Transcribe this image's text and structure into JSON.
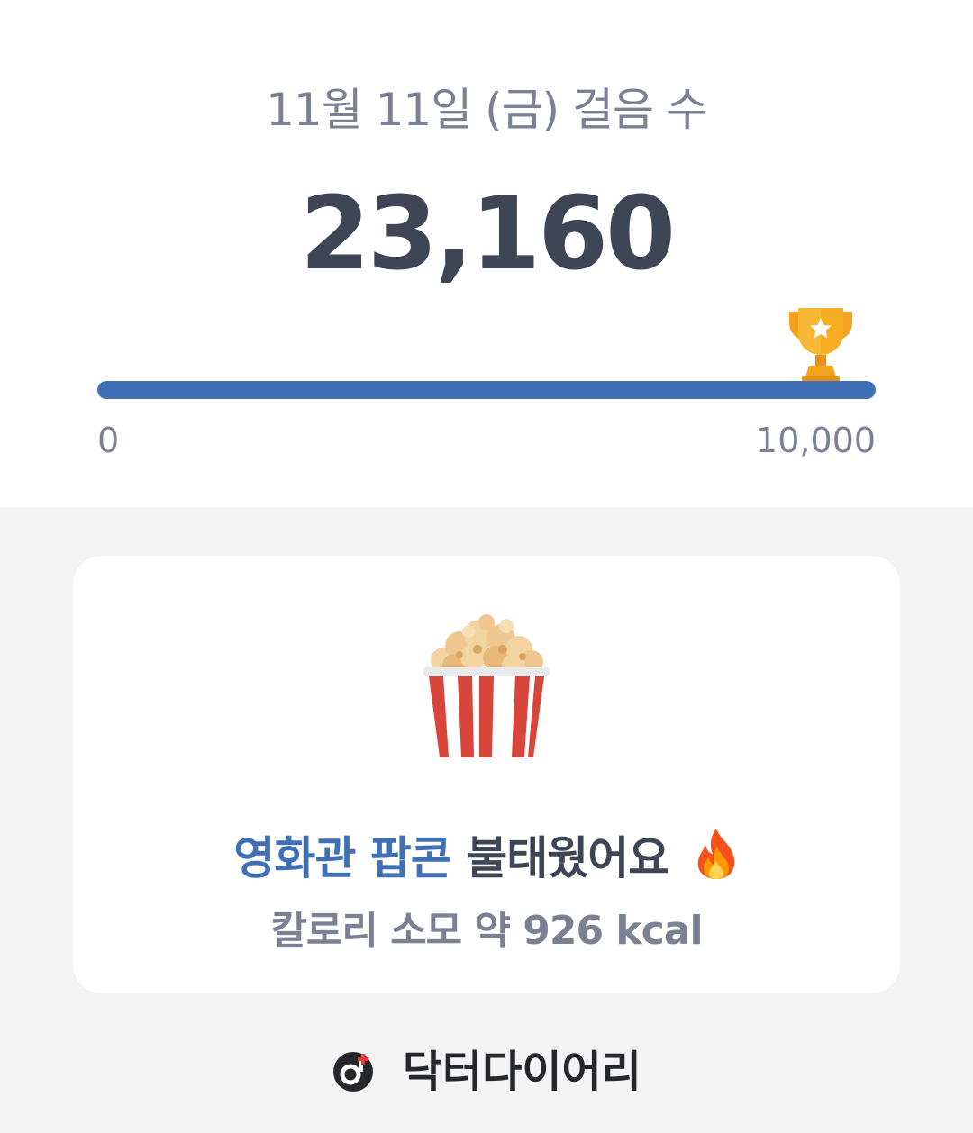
{
  "header": {
    "date_title": "11월 11일 (금) 걸음 수",
    "steps": "23,160"
  },
  "progress": {
    "value": 23160,
    "goal": 10000,
    "fraction": 1.0,
    "min_label": "0",
    "max_label": "10,000",
    "color": "#3f6fb4",
    "goal_icon": "trophy-icon"
  },
  "card": {
    "food_icon": "popcorn-icon",
    "headline_accent": "영화관 팝콘",
    "headline_rest": "불태웠어요",
    "headline_icon": "fire-icon",
    "subline": "칼로리 소모 약 926 kcal"
  },
  "footer": {
    "brand_name": "닥터다이어리",
    "brand_icon": "doctor-diary-logo-icon"
  },
  "colors": {
    "accent": "#3f6fb4",
    "text_dark": "#3e4555",
    "text_muted": "#7b8092",
    "background": "#f3f3f3"
  }
}
